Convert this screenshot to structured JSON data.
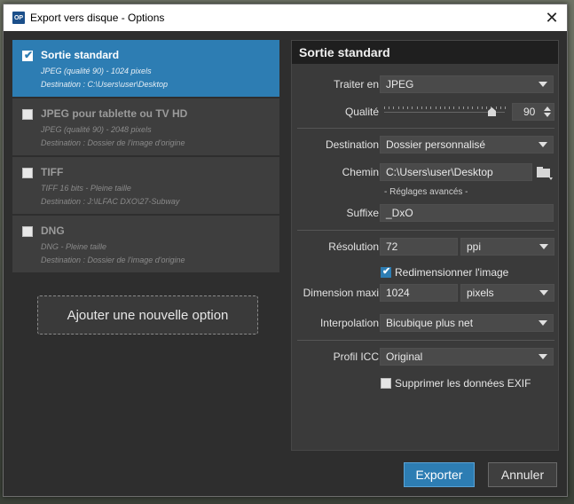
{
  "window": {
    "app_icon_text": "OP",
    "title": "Export vers disque - Options",
    "close_symbol": "✕"
  },
  "presets": [
    {
      "name": "Sortie standard",
      "line1": "JPEG (qualité 90)  -  1024 pixels",
      "line2": "Destination : C:\\Users\\user\\Desktop",
      "checked": true,
      "selected": true
    },
    {
      "name": "JPEG pour tablette ou TV HD",
      "line1": "JPEG (qualité 90)  -  2048 pixels",
      "line2": "Destination : Dossier de l'image d'origine",
      "checked": false,
      "selected": false
    },
    {
      "name": "TIFF",
      "line1": "TIFF 16 bits  -  Pleine taille",
      "line2": "Destination : J:\\ILFAC DXO\\27-Subway",
      "checked": false,
      "selected": false
    },
    {
      "name": "DNG",
      "line1": "DNG  -  Pleine taille",
      "line2": "Destination : Dossier de l'image d'origine",
      "checked": false,
      "selected": false
    }
  ],
  "add_option_label": "Ajouter une nouvelle option",
  "options": {
    "header": "Sortie standard",
    "format_label": "Traiter en",
    "format_value": "JPEG",
    "quality_label": "Qualité",
    "quality_value": "90",
    "quality_level": 90,
    "destination_label": "Destination",
    "destination_value": "Dossier personnalisé",
    "path_label": "Chemin",
    "path_value": "C:\\Users\\user\\Desktop",
    "advanced_link": "- Réglages avancés -",
    "suffix_label": "Suffixe",
    "suffix_value": "_DxO",
    "resolution_label": "Résolution",
    "resolution_value": "72",
    "resolution_unit": "ppi",
    "resize_label": "Redimensionner l'image",
    "resize_checked": true,
    "max_dim_label": "Dimension maxi",
    "max_dim_value": "1024",
    "max_dim_unit": "pixels",
    "interpolation_label": "Interpolation",
    "interpolation_value": "Bicubique plus net",
    "icc_label": "Profil ICC",
    "icc_value": "Original",
    "strip_exif_label": "Supprimer les données EXIF",
    "strip_exif_checked": false
  },
  "buttons": {
    "export": "Exporter",
    "cancel": "Annuler"
  },
  "colors": {
    "accent": "#2d7db3"
  }
}
